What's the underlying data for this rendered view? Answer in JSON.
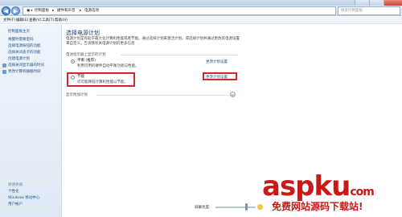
{
  "window": {
    "title_bar": ""
  },
  "address": {
    "crumbs": [
      "控制面板",
      "硬件和声音",
      "电源选项"
    ],
    "search_placeholder": "搜索控制面板"
  },
  "menu": [
    "文件(F)",
    "编辑(E)",
    "查看(V)",
    "工具(T)",
    "帮助(H)"
  ],
  "sidebar": {
    "links": [
      "控制面板主页",
      "唤醒时需要密码",
      "选择电源按钮的功能",
      "选择关闭盖子的功能",
      "创建电源计划",
      "选择关闭显示器的时间",
      "更改计算机睡眠时间"
    ],
    "see_also_title": "另请参阅",
    "see_also": [
      "个性化",
      "Windows 移动中心",
      "用户帐户"
    ]
  },
  "main": {
    "heading": "选择电源计划",
    "intro_lines": [
      "电源计划是有助于最大化计算机性能或者节能。通过选择计划来激活计划，或选择计划并通过更改其电源设置",
      "来自定义。告诉我有关电源计划的更多信息"
    ],
    "group_label": "电池指示器上显示的计划",
    "plans": [
      {
        "name": "平衡 (推荐)",
        "description": "利用可用的硬件自动平衡功耗与性能。",
        "change_link": "更改计划设置",
        "selected": true
      },
      {
        "name": "节能",
        "description": "尽可能降低计算机性能以节能。",
        "change_link": "更改计划设置",
        "selected": false
      }
    ],
    "show_more": "显示附加计划"
  },
  "status": {
    "brightness_label": "屏幕亮度:"
  },
  "watermark": {
    "logo": "aspku",
    "logo_suffix": "com",
    "tagline": "免费网站源码下载站!"
  }
}
